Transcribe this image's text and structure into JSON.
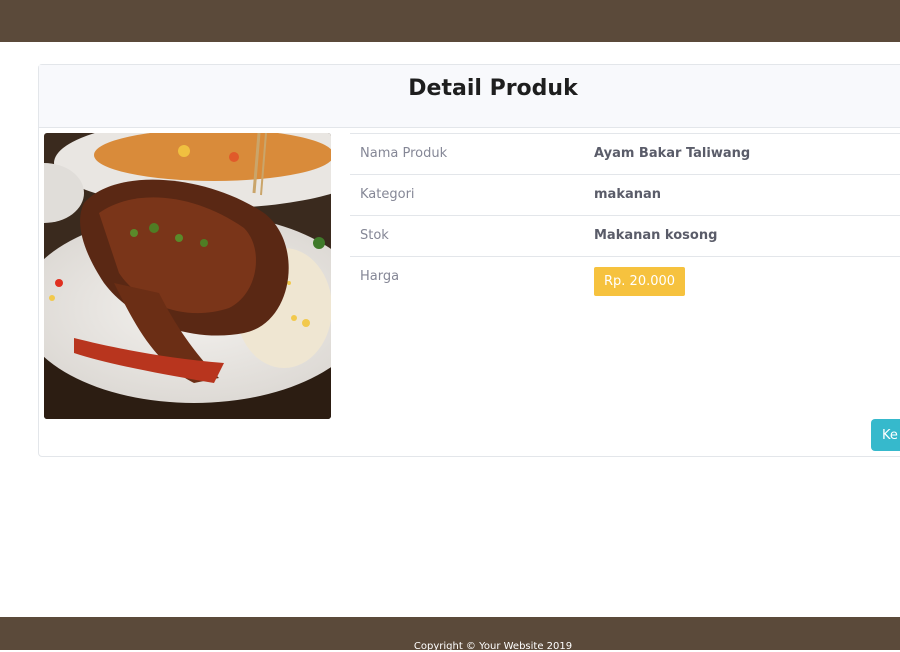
{
  "card": {
    "title": "Detail Produk"
  },
  "product": {
    "image_alt": "Ayam Bakar Taliwang",
    "rows": [
      {
        "label": "Nama Produk",
        "value": "Ayam Bakar Taliwang"
      },
      {
        "label": "Kategori",
        "value": "makanan"
      },
      {
        "label": "Stok",
        "value": "Makanan kosong"
      },
      {
        "label": "Harga",
        "value": "Rp. 20.000"
      }
    ]
  },
  "actions": {
    "back_label": "Ke"
  },
  "footer": {
    "text": "Copyright © Your Website 2019"
  },
  "colors": {
    "nav": "#5b4a3a",
    "price_badge": "#f6c23e",
    "back_button": "#36b9cc"
  }
}
